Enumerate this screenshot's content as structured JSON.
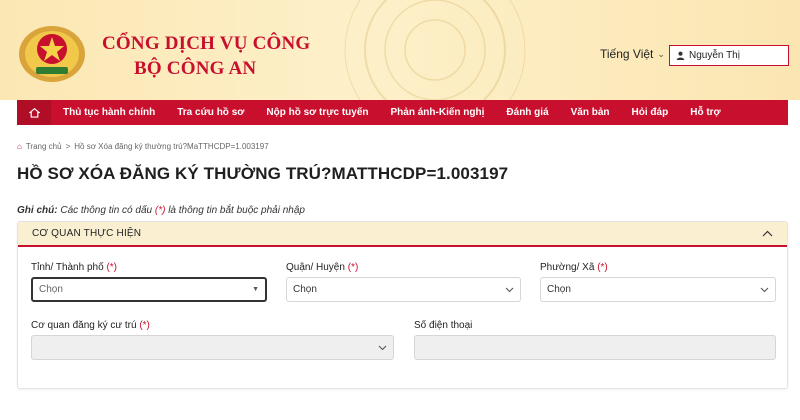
{
  "header": {
    "title_line1": "CỔNG DỊCH VỤ CÔNG",
    "title_line2": "BỘ CÔNG AN",
    "language": "Tiếng Việt",
    "user_name": "Nguyễn Thị",
    "brand_red": "#c8102e"
  },
  "nav": {
    "items": [
      "Thủ tục hành chính",
      "Tra cứu hồ sơ",
      "Nộp hồ sơ trực tuyến",
      "Phản ánh-Kiến nghị",
      "Đánh giá",
      "Văn bản",
      "Hỏi đáp",
      "Hỗ trợ"
    ]
  },
  "breadcrumb": {
    "home": "Trang chủ",
    "current": "Hồ sơ Xóa đăng ký thường trú?MaTTHCDP=1.003197"
  },
  "page": {
    "title": "HỒ SƠ XÓA ĐĂNG KÝ THƯỜNG TRÚ?MATTHCDP=1.003197",
    "note_label": "Ghi chú:",
    "note_text_1": "Các thông tin có dấu",
    "note_req": "(*)",
    "note_text_2": "là thông tin bắt buộc phải nhập"
  },
  "section": {
    "title": "CƠ QUAN THỰC HIỆN",
    "required_mark": "(*)",
    "fields": {
      "province_label": "Tỉnh/ Thành phố",
      "province_value": "Chọn",
      "district_label": "Quận/ Huyện",
      "district_value": "Chọn",
      "ward_label": "Phường/ Xã",
      "ward_value": "Chọn",
      "agency_label": "Cơ quan đăng ký cư trú",
      "agency_value": "",
      "phone_label": "Số điện thoại",
      "phone_value": ""
    }
  }
}
